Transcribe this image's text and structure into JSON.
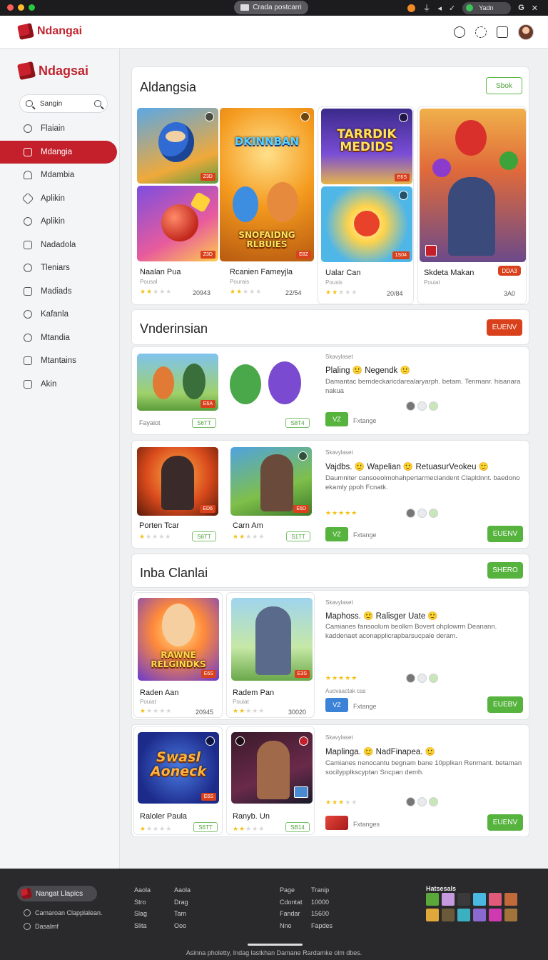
{
  "os": {
    "url": "Crada postcarri",
    "pill_label": "Yadn",
    "right_label": "G"
  },
  "header": {
    "app_name": "Ndangai"
  },
  "sidebar": {
    "logo": "Ndagsai",
    "search_placeholder": "Sangin",
    "items": [
      {
        "label": "Flaiain",
        "icon": "search-icon"
      },
      {
        "label": "Mdangia",
        "icon": "calendar-icon",
        "active": true
      },
      {
        "label": "Mdambia",
        "icon": "cloud-icon"
      },
      {
        "label": "Aplikin",
        "icon": "send-icon"
      },
      {
        "label": "Aplikin",
        "icon": "chat-icon"
      },
      {
        "label": "Nadadola",
        "icon": "grid-icon"
      },
      {
        "label": "Tleniars",
        "icon": "eye-icon"
      },
      {
        "label": "Madiads",
        "icon": "image-icon"
      },
      {
        "label": "Kafanla",
        "icon": "chat-icon"
      },
      {
        "label": "Mtandia",
        "icon": "clock-icon"
      },
      {
        "label": "Mtantains",
        "icon": "document-icon"
      },
      {
        "label": "Akin",
        "icon": "edit-icon"
      }
    ]
  },
  "section1": {
    "title": "Aldangsia",
    "button": "Sbok",
    "games": [
      {
        "title": "Naalan Pua",
        "sub": "Pousal",
        "rating": 2,
        "count": "20943",
        "tag": "Z3D",
        "art_text": ""
      },
      {
        "title": "Rcanien Fameyjla",
        "sub": "Pourais",
        "rating": 2,
        "count": "22/54",
        "tag": "E8Z",
        "art_text": "DKINNBAN",
        "art_text2": "SNOFAIDNG RLBUIES"
      },
      {
        "title": "Ualar Can",
        "sub": "Pousis",
        "rating": 2,
        "count": "20/84",
        "tag": "1S04",
        "art_text": "TARRDIK MEDIDS"
      },
      {
        "title": "Skdeta Makan",
        "sub": "Pouiat",
        "count": "3A0",
        "tag": "DDA3",
        "art_text": ""
      }
    ]
  },
  "section2": {
    "title": "Vnderinsian",
    "button": "EUENV",
    "rows": [
      {
        "items": [
          {
            "title": "Fayaiot",
            "tag": "S6TT"
          },
          {
            "title": "",
            "tag": "S8T4"
          }
        ],
        "small": "Skavylaset",
        "heading": "Plaling 🙂 Negendk 🙂",
        "body": "Damantac bemdeckaricdarealaryarph. betam. Tenmanr. hisanara nakua",
        "score": "VZ",
        "score_label": "Fxtange",
        "rating": 0,
        "button": ""
      },
      {
        "items": [
          {
            "title": "Porten Tcar",
            "tag": "S6TT",
            "rating": 1
          },
          {
            "title": "Carn Am",
            "tag": "S1TT",
            "rating": 2
          }
        ],
        "small": "Skavylaset",
        "heading": "Vajdbs. 🙂 Wapelian 🙂 RetuasurVeokeu 🙂",
        "body": "Daumniter cansoeolmohahpertarmeclandent Clapldnnt. baedono ekamly ppoh Fcnatk.",
        "score": "VZ",
        "score_label": "Fxtange",
        "rating": 5,
        "button": "EUENV"
      }
    ]
  },
  "section3": {
    "title": "Inba Clanlai",
    "button": "SHERO",
    "rows": [
      {
        "items": [
          {
            "title": "Raden Aan",
            "sub": "Pouiat",
            "rating": 1,
            "count": "20945",
            "art_text": "RAWNE RELGINDKS"
          },
          {
            "title": "Radem Pan",
            "sub": "Pouiat",
            "rating": 2,
            "count": "30020",
            "art_text": ""
          }
        ],
        "small": "Skavylaset",
        "heading": "Maphoss. 🙂 Ralisger Uate 🙂",
        "body": "Camianes fansoolum beolkm Bovert ohplowrm Deanann. kaddenaet aconapplicrapbarsucpale deram.",
        "score_small": "Auovaactak cas",
        "score": "VZ",
        "score_label": "Fxtange",
        "rating": 5,
        "button": "EUEBV"
      },
      {
        "items": [
          {
            "title": "Raloler Paula",
            "tag": "S6TT",
            "rating": 1,
            "art_text": "Swasl Aoneck"
          },
          {
            "title": "Ranyb. Un",
            "tag": "SB14",
            "rating": 2,
            "art_text": ""
          }
        ],
        "small": "Skavylaset",
        "heading": "Maplinga. 🙂 NadFinapea. 🙂",
        "body": "Camianes nenocantu begnam bane 10pplkan Renmant. betaman socilypplkscyptan Sncpan demh.",
        "score": "",
        "score_label": "Fxtanges",
        "rating": 3,
        "button": "EUENV"
      }
    ]
  },
  "footer": {
    "brand": "Nangat Llapics",
    "line1": "Camaroan Clapplalean.",
    "line2": "Dasalmf",
    "col1": [
      "Aaola",
      "Stro",
      "Slag",
      "Slita"
    ],
    "col2": [
      "Aaola",
      "Drag",
      "Tam",
      "Ooo"
    ],
    "col3": [
      "Page",
      "Cdontat",
      "Fandar",
      "Nno"
    ],
    "col4": [
      "Tranip",
      "10000",
      "15600",
      "Fapdes"
    ],
    "thumbs_title": "Hatsesals",
    "copyright": "Asinna pholetty, Indag lastkhan Damane Rardamke olm dbes."
  },
  "colors": {
    "brand_red": "#c3202b",
    "accent_green": "#55b33e",
    "accent_orange": "#d9401c"
  }
}
